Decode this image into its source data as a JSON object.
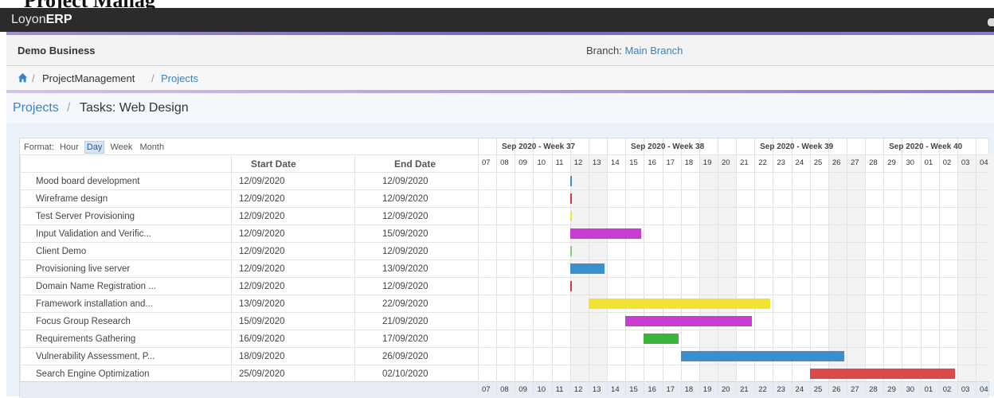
{
  "top_clip_text": "Project Manag",
  "app": {
    "brand_prefix": "Loyon",
    "brand_suffix": "ERP"
  },
  "business": {
    "name": "Demo Business",
    "branch_label": "Branch:",
    "branch_value": "Main Branch"
  },
  "breadcrumb": {
    "sep": "/",
    "module": "ProjectManagement",
    "current": "Projects"
  },
  "page_title": {
    "parent": "Projects",
    "sep": "/",
    "current": "Tasks: Web Design"
  },
  "gantt": {
    "format_label": "Format:",
    "formats": [
      "Hour",
      "Day",
      "Week",
      "Month"
    ],
    "active_format": "Day",
    "columns": {
      "start": "Start Date",
      "end": "End Date"
    },
    "weeks": [
      "Sep 2020 - Week 37",
      "Sep 2020 - Week 38",
      "Sep 2020 - Week 39",
      "Sep 2020 - Week 40"
    ],
    "days": [
      "07",
      "08",
      "09",
      "10",
      "11",
      "12",
      "13",
      "14",
      "15",
      "16",
      "17",
      "18",
      "19",
      "20",
      "21",
      "22",
      "23",
      "24",
      "25",
      "26",
      "27",
      "28",
      "29",
      "30",
      "01",
      "02",
      "03",
      "04"
    ],
    "weekend_indices": [
      5,
      6,
      12,
      13,
      19,
      20,
      26,
      27
    ],
    "tasks": [
      {
        "name": "Mood board development",
        "start": "12/09/2020",
        "end": "12/09/2020",
        "start_idx": 5,
        "end_idx": 5,
        "color": "#3a8fd0",
        "thin": true
      },
      {
        "name": "Wireframe design",
        "start": "12/09/2020",
        "end": "12/09/2020",
        "start_idx": 5,
        "end_idx": 5,
        "color": "#d63a3a",
        "thin": true
      },
      {
        "name": "Test Server Provisioning",
        "start": "12/09/2020",
        "end": "12/09/2020",
        "start_idx": 5,
        "end_idx": 5,
        "color": "#f2e233",
        "thin": true
      },
      {
        "name": "Input Validation and Verific...",
        "start": "12/09/2020",
        "end": "15/09/2020",
        "start_idx": 5,
        "end_idx": 8,
        "color": "#c83ccf",
        "thin": false
      },
      {
        "name": "Client Demo",
        "start": "12/09/2020",
        "end": "12/09/2020",
        "start_idx": 5,
        "end_idx": 5,
        "color": "#7ad27a",
        "thin": true
      },
      {
        "name": "Provisioning live server",
        "start": "12/09/2020",
        "end": "13/09/2020",
        "start_idx": 5,
        "end_idx": 6,
        "color": "#3a8fd0",
        "thin": false
      },
      {
        "name": "Domain Name Registration ...",
        "start": "12/09/2020",
        "end": "12/09/2020",
        "start_idx": 5,
        "end_idx": 5,
        "color": "#d63a3a",
        "thin": true
      },
      {
        "name": "Framework installation and...",
        "start": "13/09/2020",
        "end": "22/09/2020",
        "start_idx": 6,
        "end_idx": 15,
        "color": "#f2e233",
        "thin": false
      },
      {
        "name": "Focus Group Research",
        "start": "15/09/2020",
        "end": "21/09/2020",
        "start_idx": 8,
        "end_idx": 14,
        "color": "#c83ccf",
        "thin": false
      },
      {
        "name": "Requirements Gathering",
        "start": "16/09/2020",
        "end": "17/09/2020",
        "start_idx": 9,
        "end_idx": 10,
        "color": "#3cb43c",
        "thin": false
      },
      {
        "name": "Vulnerability Assessment, P...",
        "start": "18/09/2020",
        "end": "26/09/2020",
        "start_idx": 11,
        "end_idx": 19,
        "color": "#3a8fd0",
        "thin": false
      },
      {
        "name": "Search Engine Optimization",
        "start": "25/09/2020",
        "end": "02/10/2020",
        "start_idx": 18,
        "end_idx": 25,
        "color": "#d94a4a",
        "thin": false
      }
    ]
  }
}
